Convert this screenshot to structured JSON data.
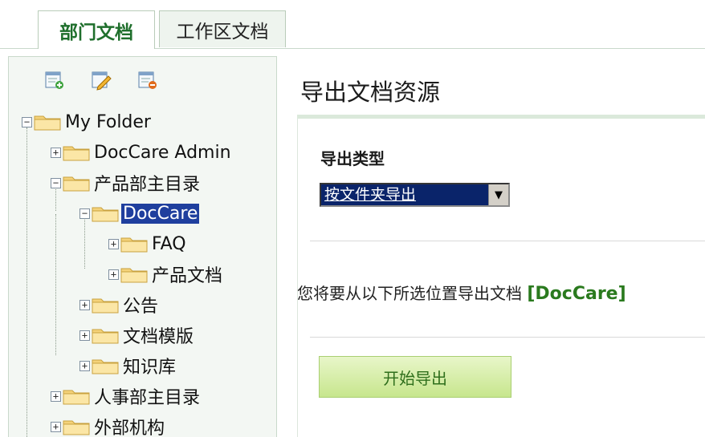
{
  "tabs": [
    {
      "label": "部门文档",
      "active": true
    },
    {
      "label": "工作区文档",
      "active": false
    }
  ],
  "toolbar": {
    "icons": [
      "new-document-icon",
      "edit-document-icon",
      "delete-document-icon"
    ]
  },
  "tree": {
    "nodes": [
      {
        "label": "My Folder",
        "expander": "−"
      },
      {
        "label": "DocCare Admin",
        "expander": "+"
      },
      {
        "label": "产品部主目录",
        "expander": "−"
      },
      {
        "label": "DocCare",
        "expander": "−",
        "selected": true
      },
      {
        "label": "FAQ",
        "expander": "+"
      },
      {
        "label": "产品文档",
        "expander": "+"
      },
      {
        "label": "公告",
        "expander": "+"
      },
      {
        "label": "文档模版",
        "expander": "+"
      },
      {
        "label": "知识库",
        "expander": "+"
      },
      {
        "label": "人事部主目录",
        "expander": "+"
      },
      {
        "label": "外部机构",
        "expander": "+"
      }
    ]
  },
  "main": {
    "title": "导出文档资源",
    "export_type_label": "导出类型",
    "export_type_value": "按文件夹导出",
    "info_prefix": "您将要从以下所选位置导出文档 ",
    "info_path": "[DocCare]",
    "start_button": "开始导出"
  },
  "colors": {
    "accent_green": "#1f6f2c",
    "selection_blue": "#1f3f9e",
    "button_green": "#c7e68d"
  }
}
